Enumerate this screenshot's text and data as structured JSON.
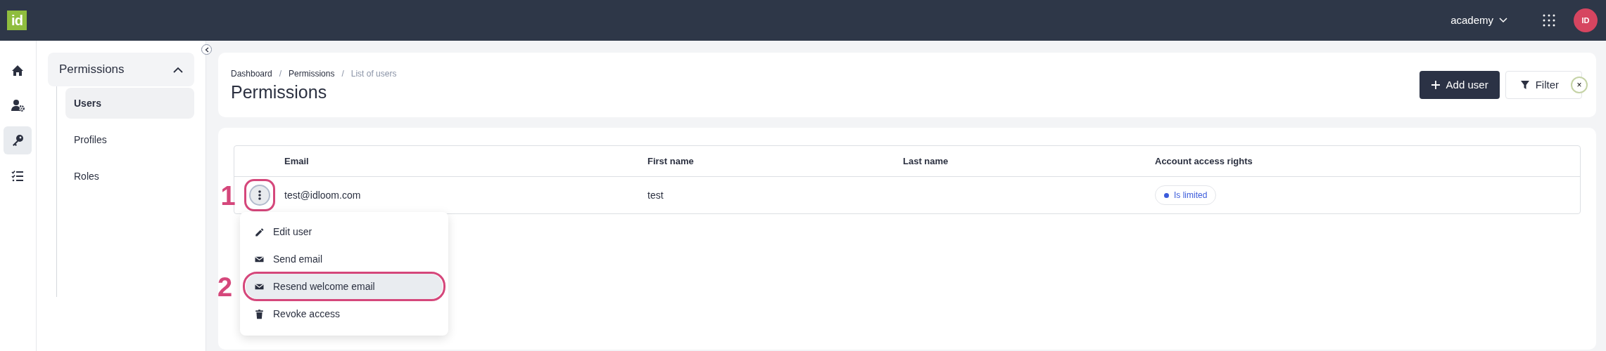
{
  "topbar": {
    "logo": "id",
    "account": "academy",
    "avatar": "ID"
  },
  "rail": [
    {
      "kind": "home",
      "selected": false
    },
    {
      "kind": "user-gear",
      "selected": false
    },
    {
      "kind": "key",
      "selected": true
    },
    {
      "kind": "checklist",
      "selected": false
    }
  ],
  "sidebar": {
    "title": "Permissions",
    "expanded": true,
    "items": [
      {
        "label": "Users",
        "selected": true
      },
      {
        "label": "Profiles",
        "selected": false
      },
      {
        "label": "Roles",
        "selected": false
      }
    ]
  },
  "breadcrumb_separator": "/",
  "breadcrumbs": [
    {
      "label": "Dashboard",
      "current": false
    },
    {
      "label": "Permissions",
      "current": false
    },
    {
      "label": "List of users",
      "current": true
    }
  ],
  "page_title": "Permissions",
  "actions": [
    {
      "kind": "add",
      "label": "Add user"
    },
    {
      "kind": "filter",
      "label": "Filter",
      "clear": "×"
    }
  ],
  "table": {
    "columns": [
      "Email",
      "First name",
      "Last name",
      "Account access rights"
    ],
    "rows": [
      {
        "email": "test@idloom.com",
        "first_name": "test",
        "access": {
          "label": "Is limited",
          "color": "#3b5bdb"
        },
        "callout": "1",
        "menu_open": true
      }
    ]
  },
  "menu": {
    "items": [
      {
        "kind": "edit",
        "label": "Edit user",
        "selected": false
      },
      {
        "kind": "mail",
        "label": "Send email",
        "selected": false
      },
      {
        "kind": "mail",
        "label": "Resend welcome email",
        "selected": true,
        "callout": "2"
      },
      {
        "kind": "trash",
        "label": "Revoke access",
        "selected": false
      }
    ]
  }
}
